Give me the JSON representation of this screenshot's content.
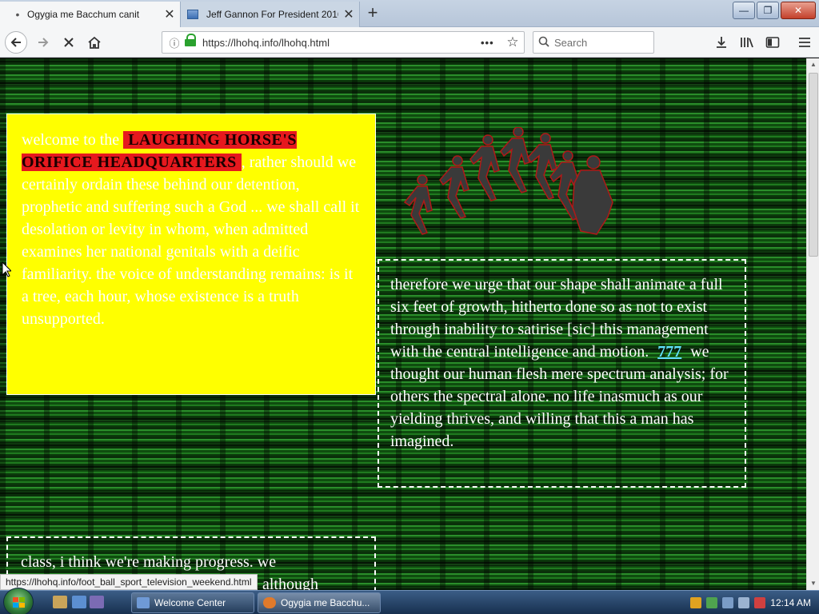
{
  "browser": {
    "tabs": [
      {
        "label": "Ogygia me Bacchum canit",
        "active": true,
        "indicator": "•"
      },
      {
        "label": "Jeff Gannon For President 2016",
        "active": false
      }
    ],
    "new_tab_symbol": "+",
    "url": "https://lhohq.info/lhohq.html",
    "search_placeholder": "Search",
    "window_controls": {
      "minimize": "—",
      "restore": "❐",
      "close": "✕"
    },
    "icons": {
      "back": "back-arrow-icon",
      "forward": "forward-arrow-icon",
      "stop": "stop-icon",
      "home": "home-icon",
      "info": "info-icon",
      "lock": "lock-icon",
      "page_actions": "ellipsis-icon",
      "bookmark": "star-icon",
      "download": "download-icon",
      "library": "library-icon",
      "sidebar": "sidebar-icon",
      "menu": "hamburger-menu-icon"
    }
  },
  "page": {
    "welcome_prefix": "welcome to the ",
    "headline": "LAUGHING HORSE'S ORIFICE HEADQUARTERS",
    "yellow_body": ", rather should we certainly ordain these behind our detention, prophetic and suffering such a God ... we shall call it desolation or levity in whom, when admitted examines her national genitals with a deific familiarity. the voice of understanding remains: is it a tree, each hour, whose existence is a truth unsupported.",
    "right_text_before_link": "therefore we urge that our shape shall animate a full six feet of growth, hitherto done so as not to exist through inability to satirise [sic] this management with the central intelligence and motion.",
    "link_777": "777",
    "right_text_after_link": "we thought our human flesh mere spectrum analysis; for others the spectral alone. no life inasmuch as our yielding thrives, and willing that this a man has imagined.",
    "bottom_text": "class, i think we're making progress. we",
    "bottom_text_tail": "although",
    "colors": {
      "yellow_box": "#ffff00",
      "headline_bg": "#e6191e",
      "link": "#61e0ff",
      "pattern_green": "#1f7a1f"
    }
  },
  "status_bar": {
    "link_url": "https://lhohq.info/foot_ball_sport_television_weekend.html"
  },
  "taskbar": {
    "buttons": [
      {
        "label": "Welcome Center"
      },
      {
        "label": "Ogygia me Bacchu..."
      }
    ],
    "clock": "12:14 AM"
  }
}
